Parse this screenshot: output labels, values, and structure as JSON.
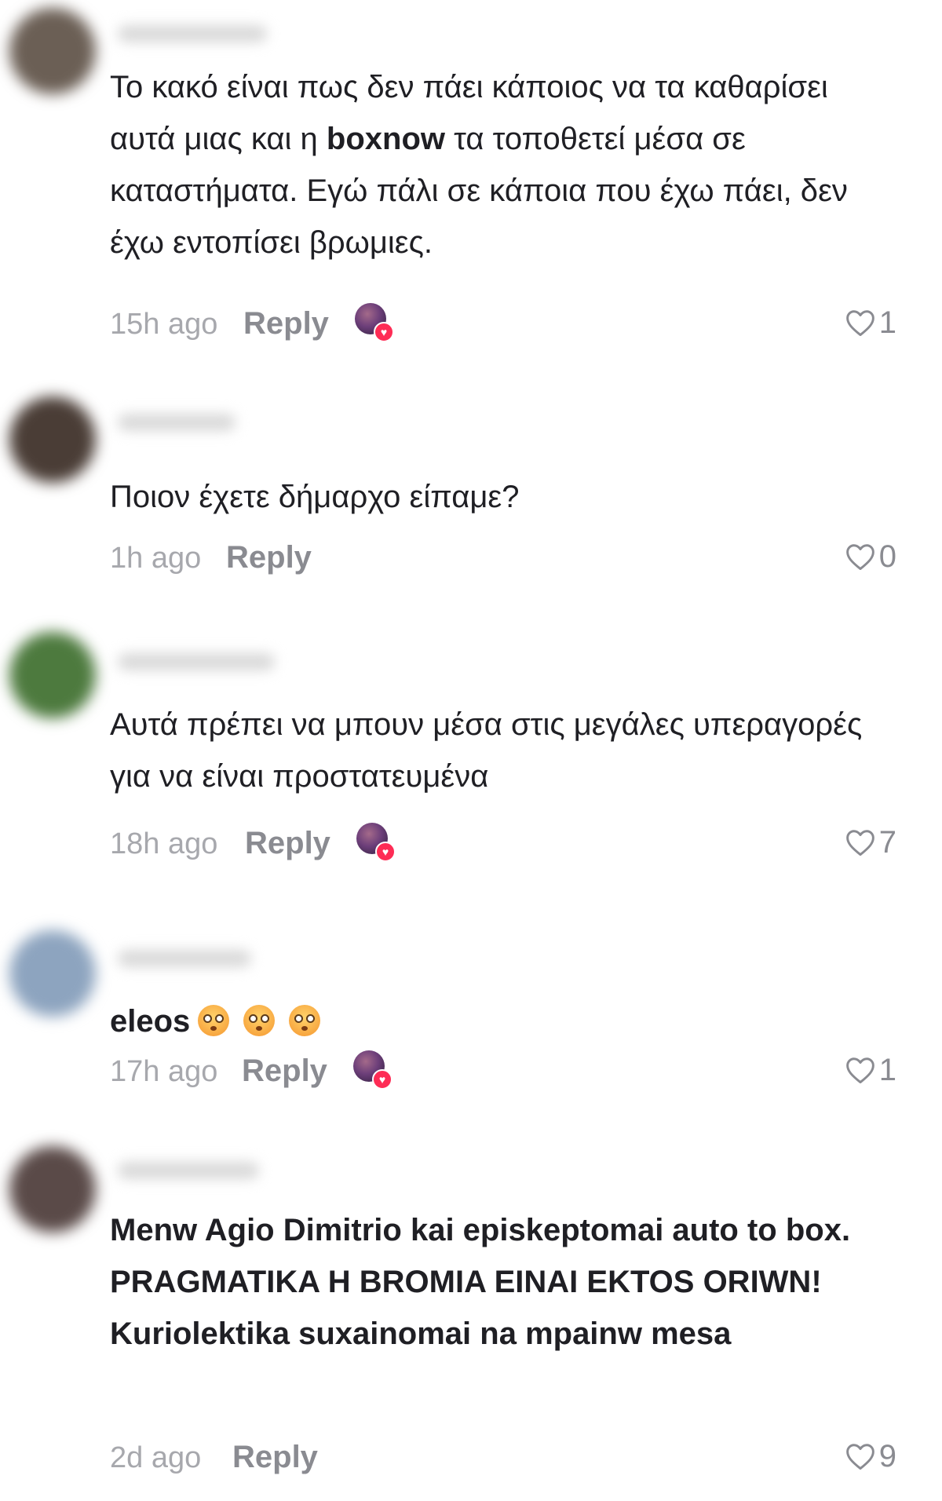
{
  "comments": [
    {
      "text_parts": [
        "Το κακό είναι πως δεν πάει κάποιος να τα καθαρίσει αυτά μιας και η ",
        "boxnow",
        " τα τοποθετεί μέσα σε καταστήματα. Εγώ πάλι σε κάποια που έχω πάει, δεν έχω εντοπίσει βρωμιες."
      ],
      "time": "15h ago",
      "reply": "Reply",
      "liked_by_creator": true,
      "likes": "1",
      "avatar_color": "#6b5f55"
    },
    {
      "text_parts": [
        "Ποιον έχετε δήμαρχο είπαμε?"
      ],
      "time": "1h ago",
      "reply": "Reply",
      "liked_by_creator": false,
      "likes": "0",
      "avatar_color": "#4a3d36"
    },
    {
      "text_parts": [
        "Αυτά πρέπει να μπουν μέσα στις μεγάλες υπεραγορές για να είναι προστατευμένα"
      ],
      "time": "18h ago",
      "reply": "Reply",
      "liked_by_creator": true,
      "likes": "7",
      "avatar_color": "#4d7a3e"
    },
    {
      "text_parts": [
        "eleos"
      ],
      "time": "17h ago",
      "reply": "Reply",
      "liked_by_creator": true,
      "likes": "1",
      "avatar_color": "#8da4bf",
      "emoji_name": "flushed-face",
      "emoji_count": 3
    },
    {
      "text_parts": [
        "Menw Agio Dimitrio kai episkeptomai auto to box. PRAGMATIKA H BROMIA EINAI EKTOS ORIWN! Kuriolektika suxainomai na mpainw mesa"
      ],
      "time": "2d ago",
      "reply": "Reply",
      "liked_by_creator": false,
      "likes": "9",
      "avatar_color": "#5a4a48"
    }
  ],
  "icons": {
    "like": "heart-outline-icon",
    "creator_liked": "creator-liked-badge"
  },
  "colors": {
    "text": "#1f1f24",
    "muted": "#a7a8ad",
    "reply": "#8a8b91",
    "badge": "#fe2c55"
  }
}
